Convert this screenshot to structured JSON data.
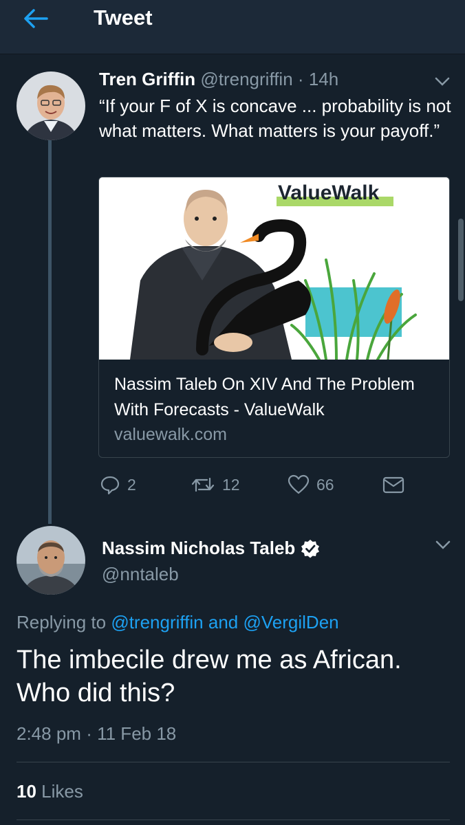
{
  "header": {
    "title": "Tweet"
  },
  "quoted_tweet": {
    "author_name": "Tren Griffin",
    "author_handle": "@trengriffin",
    "separator": "·",
    "time_ago": "14h",
    "text": "“If your F of X is concave ... probability is not what matters. What matters is your payoff.”",
    "card": {
      "image_brand": "ValueWalk",
      "title": "Nassim Taleb On XIV And The Problem With Forecasts - ValueWalk",
      "domain": "valuewalk.com"
    },
    "actions": {
      "replies": "2",
      "retweets": "12",
      "likes": "66"
    }
  },
  "main_tweet": {
    "author_name": "Nassim Nicholas Taleb",
    "author_handle": "@nntaleb",
    "verified": true,
    "replying_prefix": "Replying to",
    "reply_user_1": "@trengriffin",
    "reply_conj": "and",
    "reply_user_2": "@VergilDen",
    "text": "The imbecile drew me as African. Who did this?",
    "time": "2:48 pm",
    "separator": "·",
    "date": "11 Feb 18",
    "likes_count": "10",
    "likes_label": "Likes"
  },
  "colors": {
    "background": "#15202b",
    "header_bg": "#1c2938",
    "accent": "#1da1f2",
    "muted_text": "#8899a6",
    "divider": "#38444d"
  },
  "icons": [
    "back-arrow-icon",
    "chevron-down-icon",
    "reply-icon",
    "retweet-icon",
    "heart-icon",
    "mail-icon",
    "verified-badge-icon"
  ]
}
